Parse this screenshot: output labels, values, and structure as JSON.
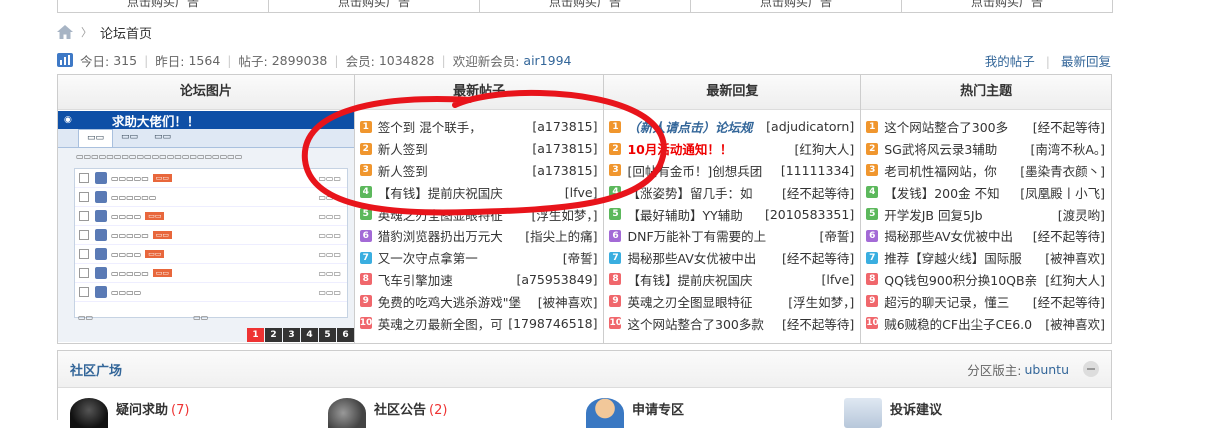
{
  "ads": [
    "点击购买广告",
    "点击购买广告",
    "点击购买广告",
    "点击购买广告",
    "点击购买广告"
  ],
  "breadcrumb": {
    "current": "论坛首页"
  },
  "stats": {
    "today_label": "今日:",
    "today": "315",
    "yesterday_label": "昨日:",
    "yesterday": "1564",
    "posts_label": "帖子:",
    "posts": "2899038",
    "members_label": "会员:",
    "members": "1034828",
    "welcome_label": "欢迎新会员:",
    "newest_member": "air1994",
    "my_posts": "我的帖子",
    "latest_replies": "最新回复"
  },
  "columns": {
    "pictures": {
      "title": "论坛图片",
      "caption": "求助大佬们！！",
      "pages": [
        "1",
        "2",
        "3",
        "4",
        "5",
        "6"
      ]
    },
    "new_posts": {
      "title": "最新帖子",
      "items": [
        {
          "n": "1",
          "title": "签个到 混个联手，",
          "user": "[a173815]"
        },
        {
          "n": "2",
          "title": "新人签到",
          "user": "[a173815]"
        },
        {
          "n": "3",
          "title": "新人签到",
          "user": "[a173815]"
        },
        {
          "n": "4",
          "title": "【有钱】提前庆祝国庆",
          "user": "[lfve]"
        },
        {
          "n": "5",
          "title": "英魂之刃全图显眼特征",
          "user": "[浮生如梦，]"
        },
        {
          "n": "6",
          "title": "猎豹浏览器扔出万元大",
          "user": "[指尖上的痛]"
        },
        {
          "n": "7",
          "title": "又一次守点拿第一",
          "user": "[帝誓]"
        },
        {
          "n": "8",
          "title": "飞车引擎加速",
          "user": "[a75953849]"
        },
        {
          "n": "9",
          "title": "免费的吃鸡大逃杀游戏\"堡",
          "user": "[被神喜欢]"
        },
        {
          "n": "10",
          "title": "英魂之刃最新全图，可",
          "user": "[1798746518]"
        }
      ]
    },
    "latest_replies": {
      "title": "最新回复",
      "items": [
        {
          "n": "1",
          "title": "（新人请点击）论坛规",
          "user": "[adjudicatorn]",
          "style": "bluei"
        },
        {
          "n": "2",
          "title": "10月活动通知！！",
          "user": "[红狗大人]",
          "style": "red"
        },
        {
          "n": "3",
          "title": "[回帖有金币！]创想兵团",
          "user": "[11111334]"
        },
        {
          "n": "4",
          "title": "【涨姿势】留几手：如",
          "user": "[经不起等待]"
        },
        {
          "n": "5",
          "title": "【最好辅助】YY辅助",
          "user": "[2010583351]"
        },
        {
          "n": "6",
          "title": "DNF万能补丁有需要的上",
          "user": "[帝誓]"
        },
        {
          "n": "7",
          "title": "揭秘那些AV女优被中出",
          "user": "[经不起等待]"
        },
        {
          "n": "8",
          "title": "【有钱】提前庆祝国庆",
          "user": "[lfve]"
        },
        {
          "n": "9",
          "title": "英魂之刃全图显眼特征",
          "user": "[浮生如梦，]"
        },
        {
          "n": "10",
          "title": "这个网站整合了300多款",
          "user": "[经不起等待]"
        }
      ]
    },
    "hot_topics": {
      "title": "热门主题",
      "items": [
        {
          "n": "1",
          "title": "这个网站整合了300多",
          "user": "[经不起等待]"
        },
        {
          "n": "2",
          "title": "SG武将风云录3辅助",
          "user": "[南湾不秋A。]"
        },
        {
          "n": "3",
          "title": "老司机性福网站，你",
          "user": "[墨染青衣颜丶]"
        },
        {
          "n": "4",
          "title": "【发钱】200金 不知",
          "user": "[凤凰殿丨小飞]"
        },
        {
          "n": "5",
          "title": "开学发JB 回复5Jb",
          "user": "[渡灵哟]"
        },
        {
          "n": "6",
          "title": "揭秘那些AV女优被中出",
          "user": "[经不起等待]"
        },
        {
          "n": "7",
          "title": "推荐【穿越火线】国际服",
          "user": "[被神喜欢]"
        },
        {
          "n": "8",
          "title": "QQ钱包900积分换10QB亲",
          "user": "[红狗大人]"
        },
        {
          "n": "9",
          "title": "超污的聊天记录，懂三",
          "user": "[经不起等待]"
        },
        {
          "n": "10",
          "title": "贼6贼稳的CF出尘子CE6.0",
          "user": "[被神喜欢]"
        }
      ]
    }
  },
  "square": {
    "title": "社区广场",
    "moderator_label": "分区版主:",
    "moderator": "ubuntu",
    "forums": [
      {
        "name": "疑问求助",
        "count": "(7)"
      },
      {
        "name": "社区公告",
        "count": "(2)"
      },
      {
        "name": "申请专区",
        "count": ""
      },
      {
        "name": "投诉建议",
        "count": ""
      }
    ]
  },
  "colors": {
    "link_blue": "#336699",
    "rank_1_3": "#f0962e",
    "rank_4_5": "#5cb85c",
    "rank_6": "#a36ad6",
    "rank_7": "#3aaee0",
    "rank_8_10": "#f0676c",
    "annotation_red": "#e8141b"
  }
}
